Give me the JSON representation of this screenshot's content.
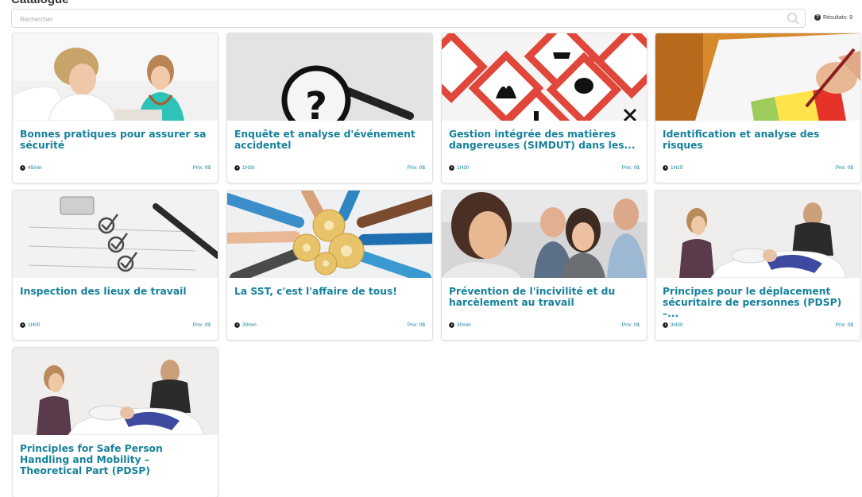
{
  "page": {
    "title": "Catalogue"
  },
  "search": {
    "placeholder": "Rechercher",
    "value": ""
  },
  "results": {
    "label": "Résultats:",
    "count": "9"
  },
  "colors": {
    "accent": "#16819b",
    "text": "#333333",
    "border": "#d9d9d9"
  },
  "icons": {
    "search": "search-icon",
    "help": "help-icon",
    "clock": "clock-icon"
  },
  "courses": [
    {
      "title": "Bonnes pratiques pour assurer sa sécurité",
      "duration": "45min",
      "price_label": "Prix:",
      "price": "0$"
    },
    {
      "title": "Enquête et analyse d'événement accidentel",
      "duration": "1H30",
      "price_label": "Prix:",
      "price": "0$"
    },
    {
      "title": "Gestion intégrée des matières dangereuses (SIMDUT) dans les...",
      "duration": "1H30",
      "price_label": "Prix:",
      "price": "0$"
    },
    {
      "title": "Identification et analyse des risques",
      "duration": "1H15",
      "price_label": "Prix:",
      "price": "0$"
    },
    {
      "title": "Inspection des lieux de travail",
      "duration": "1H00",
      "price_label": "Prix:",
      "price": "0$"
    },
    {
      "title": "La SST, c'est l'affaire de tous!",
      "duration": "30min",
      "price_label": "Prix:",
      "price": "0$"
    },
    {
      "title": "Prévention de l'incivilité et du harcèlement au travail",
      "duration": "30min",
      "price_label": "Prix:",
      "price": "0$"
    },
    {
      "title": "Principes pour le déplacement sécuritaire de personnes (PDSP) –...",
      "duration": "3H30",
      "price_label": "Prix:",
      "price": "0$"
    },
    {
      "title": "Principles for Safe Person Handling and Mobility – Theoretical Part (PDSP)",
      "duration": "",
      "price_label": "",
      "price": ""
    }
  ]
}
